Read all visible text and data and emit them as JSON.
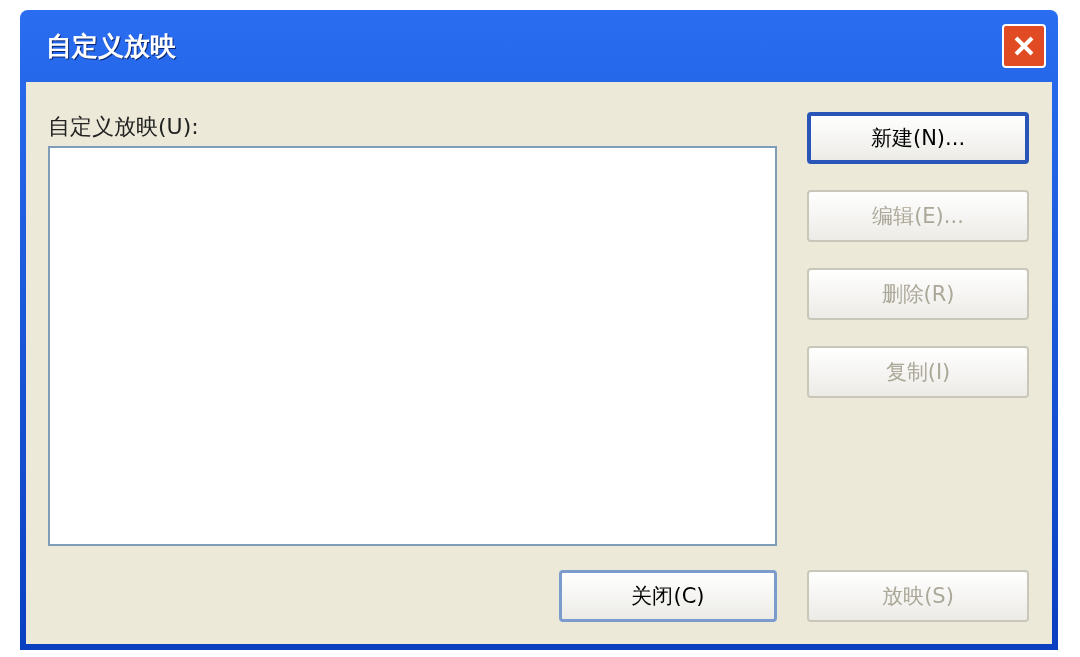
{
  "window": {
    "title": "自定义放映"
  },
  "list": {
    "label": "自定义放映(U):"
  },
  "side_buttons": [
    {
      "label": "新建(N)...",
      "disabled": false,
      "default": true
    },
    {
      "label": "编辑(E)...",
      "disabled": true,
      "default": false
    },
    {
      "label": "删除(R)",
      "disabled": true,
      "default": false
    },
    {
      "label": "复制(I)",
      "disabled": true,
      "default": false
    }
  ],
  "bottom_buttons": [
    {
      "label": "关闭(C)",
      "disabled": false,
      "default": false
    },
    {
      "label": "放映(S)",
      "disabled": true,
      "default": false
    }
  ]
}
